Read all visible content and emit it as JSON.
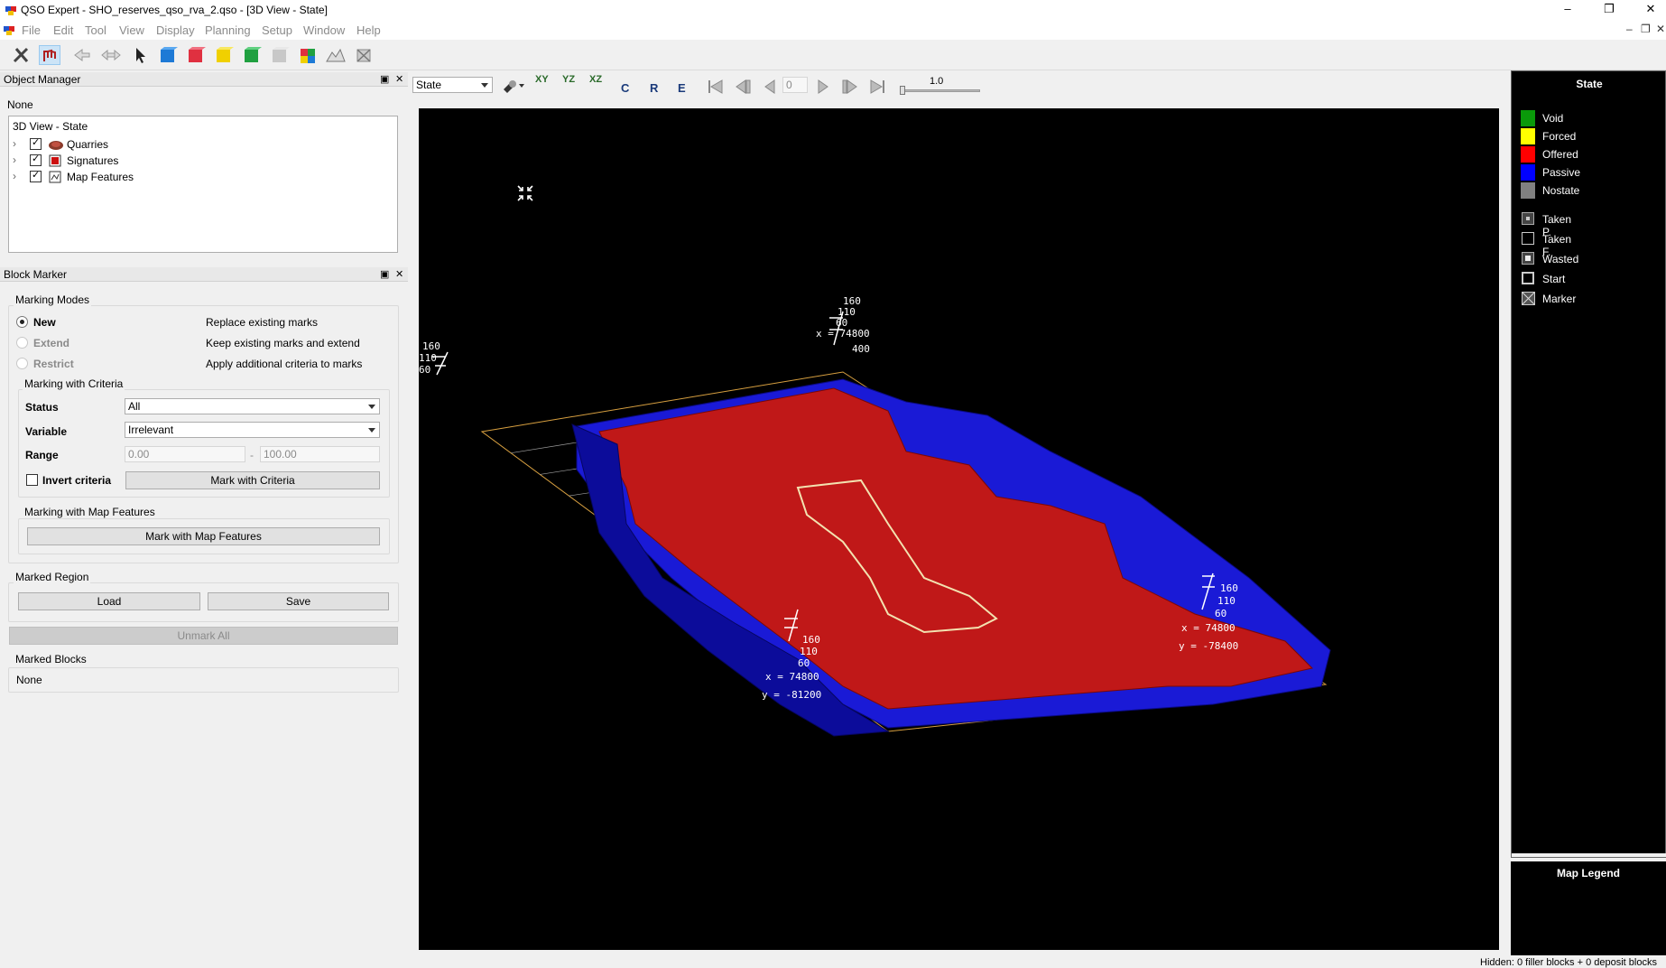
{
  "window": {
    "title": "QSO Expert - SHO_reserves_qso_rva_2.qso - [3D View - State]",
    "minimize": "–",
    "maximize": "❐",
    "close": "✕"
  },
  "menu": {
    "items": [
      "File",
      "Edit",
      "Tool",
      "View",
      "Display",
      "Planning",
      "Setup",
      "Window",
      "Help"
    ],
    "mdi_minimize": "–",
    "mdi_restore": "❐",
    "mdi_close": "✕"
  },
  "object_manager": {
    "title": "Object Manager",
    "selection": "None",
    "tree_root": "3D View - State",
    "tree_items": [
      "Quarries",
      "Signatures",
      "Map Features"
    ]
  },
  "block_marker": {
    "title": "Block Marker",
    "marking_modes_label": "Marking Modes",
    "modes": [
      {
        "label": "New",
        "desc": "Replace existing marks",
        "checked": true,
        "enabled": true
      },
      {
        "label": "Extend",
        "desc": "Keep existing marks and extend",
        "checked": false,
        "enabled": false
      },
      {
        "label": "Restrict",
        "desc": "Apply additional criteria to marks",
        "checked": false,
        "enabled": false
      }
    ],
    "criteria_label": "Marking with Criteria",
    "status_label": "Status",
    "status_value": "All",
    "variable_label": "Variable",
    "variable_value": "Irrelevant",
    "range_label": "Range",
    "range_min": "0.00",
    "range_sep": "-",
    "range_max": "100.00",
    "invert_label": "Invert criteria",
    "mark_criteria_button": "Mark with Criteria",
    "map_features_label": "Marking with Map Features",
    "mark_map_features_button": "Mark with Map Features",
    "marked_region_label": "Marked Region",
    "load_button": "Load",
    "save_button": "Save",
    "unmark_all_button": "Unmark All",
    "marked_blocks_label": "Marked Blocks",
    "marked_blocks_value": "None"
  },
  "view_toolbar": {
    "mode_value": "State",
    "buttons": [
      "XY",
      "YZ",
      "XZ",
      "C",
      "R",
      "E"
    ],
    "frame_value": "0",
    "scale_value": "1.0"
  },
  "viewport": {
    "labels_top_axis": [
      "160",
      "110",
      "60",
      "x = 74800",
      "400"
    ],
    "labels_left_axis": [
      "160",
      "110",
      "60"
    ],
    "labels_right_axis": [
      "160",
      "110",
      "60",
      "x = 74800",
      "y = -78400"
    ],
    "labels_bottom_axis": [
      "160",
      "110",
      "60",
      "x = 74800",
      "y = -81200"
    ],
    "colors": {
      "offered": "#c01818",
      "passive": "#1a1ad6",
      "grid": "#d8a040",
      "line": "#ffffff",
      "taken": "#f3e2b0"
    }
  },
  "legend": {
    "title": "State",
    "states": [
      {
        "label": "Void",
        "color": "#0a9a0a"
      },
      {
        "label": "Forced",
        "color": "#ffff00"
      },
      {
        "label": "Offered",
        "color": "#ff0000"
      },
      {
        "label": "Passive",
        "color": "#0000ff"
      },
      {
        "label": "Nostate",
        "color": "#808080"
      }
    ],
    "markers": [
      "Taken P.",
      "Taken F.",
      "Wasted",
      "Start",
      "Marker"
    ],
    "map_legend_title": "Map Legend"
  },
  "status_bar": {
    "text": "Hidden: 0 filler blocks + 0 deposit blocks"
  }
}
